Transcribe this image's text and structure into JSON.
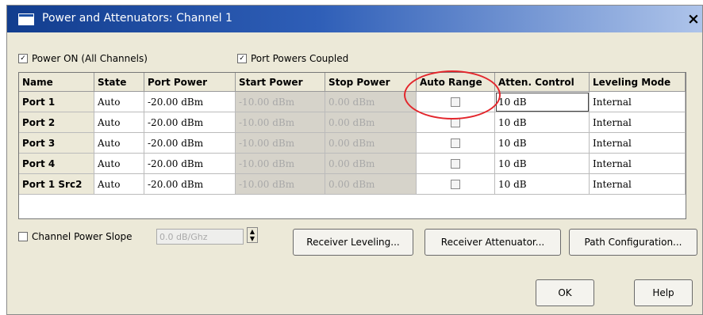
{
  "window": {
    "title": "Power and Attenuators: Channel 1",
    "close_label": "×"
  },
  "options": {
    "power_on_label": "Power ON (All Channels)",
    "power_on_checked": true,
    "port_powers_coupled_label": "Port Powers Coupled",
    "port_powers_coupled_checked": true
  },
  "table": {
    "columns": [
      "Name",
      "State",
      "Port Power",
      "Start Power",
      "Stop Power",
      "Auto Range",
      "Atten. Control",
      "Leveling Mode"
    ],
    "rows": [
      {
        "name": "Port 1",
        "state": "Auto",
        "port_power": "-20.00 dBm",
        "start_power": "-10.00 dBm",
        "stop_power": "0.00 dBm",
        "auto_range": false,
        "atten": "10 dB",
        "leveling": "Internal"
      },
      {
        "name": "Port 2",
        "state": "Auto",
        "port_power": "-20.00 dBm",
        "start_power": "-10.00 dBm",
        "stop_power": "0.00 dBm",
        "auto_range": false,
        "atten": "10 dB",
        "leveling": "Internal"
      },
      {
        "name": "Port 3",
        "state": "Auto",
        "port_power": "-20.00 dBm",
        "start_power": "-10.00 dBm",
        "stop_power": "0.00 dBm",
        "auto_range": false,
        "atten": "10 dB",
        "leveling": "Internal"
      },
      {
        "name": "Port 4",
        "state": "Auto",
        "port_power": "-20.00 dBm",
        "start_power": "-10.00 dBm",
        "stop_power": "0.00 dBm",
        "auto_range": false,
        "atten": "10 dB",
        "leveling": "Internal"
      },
      {
        "name": "Port 1 Src2",
        "state": "Auto",
        "port_power": "-20.00 dBm",
        "start_power": "-10.00 dBm",
        "stop_power": "0.00 dBm",
        "auto_range": false,
        "atten": "10 dB",
        "leveling": "Internal"
      }
    ]
  },
  "slope": {
    "label": "Channel Power Slope",
    "checked": false,
    "value": "0.0 dB/Ghz"
  },
  "buttons": {
    "receiver_leveling": "Receiver Leveling...",
    "receiver_attenuator": "Receiver Attenuator...",
    "path_configuration": "Path Configuration...",
    "ok": "OK",
    "help": "Help"
  },
  "colors": {
    "title_bar": "#123d8e",
    "dialog_bg": "#ece9d8",
    "highlight_circle": "#e3262c"
  }
}
